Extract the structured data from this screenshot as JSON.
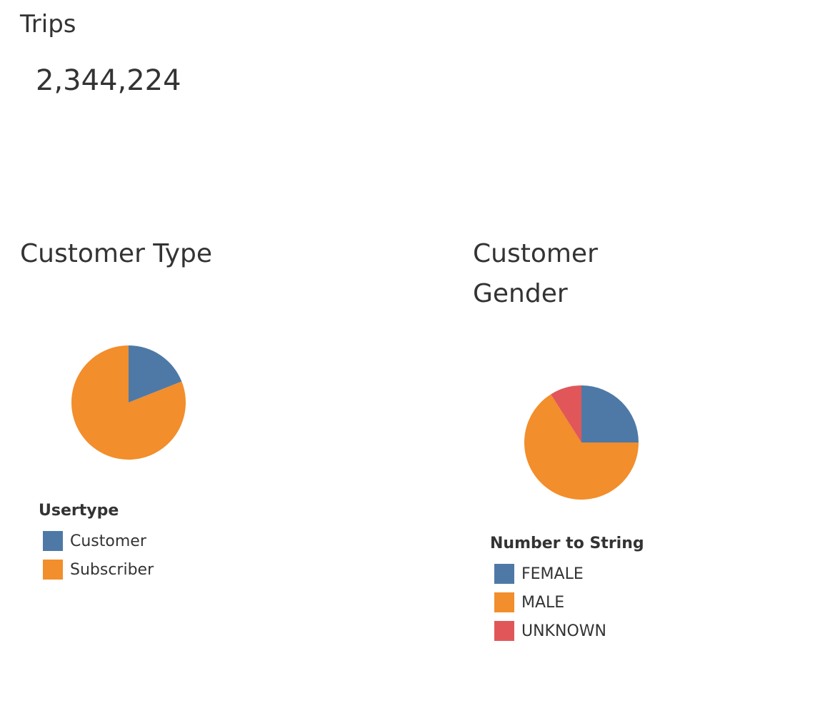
{
  "kpi": {
    "title": "Trips",
    "value": "2,344,224"
  },
  "chart_data": [
    {
      "type": "pie",
      "title": "Customer Type",
      "legend_title": "Usertype",
      "categories": [
        "Customer",
        "Subscriber"
      ],
      "values": [
        19,
        81
      ],
      "colors": [
        "#4e79a7",
        "#f28e2b"
      ]
    },
    {
      "type": "pie",
      "title": "Customer Gender",
      "legend_title": "Number to String",
      "categories": [
        "FEMALE",
        "MALE",
        "UNKNOWN"
      ],
      "values": [
        25,
        66,
        9
      ],
      "colors": [
        "#4e79a7",
        "#f28e2b",
        "#e15759"
      ]
    }
  ]
}
